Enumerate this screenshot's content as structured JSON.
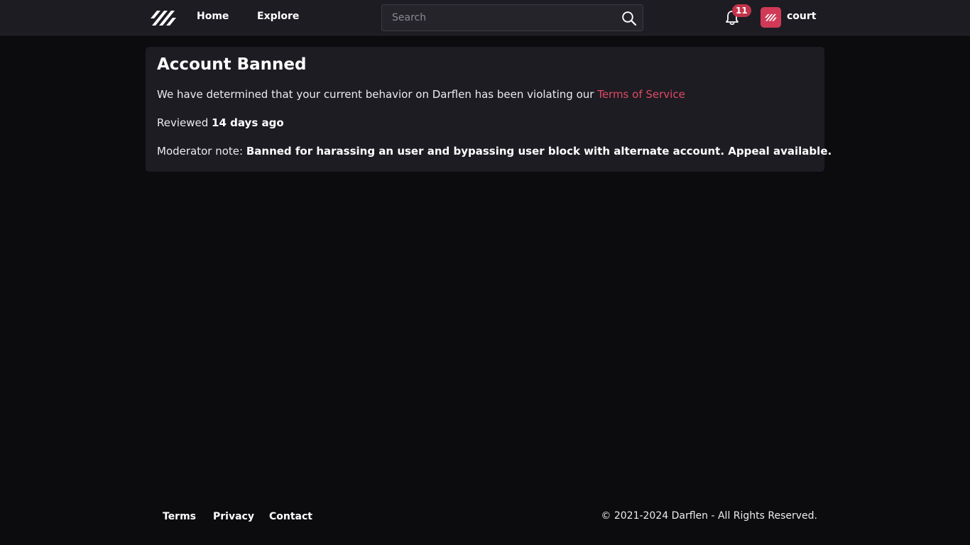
{
  "nav": {
    "logo_icon": "darflen-logo-icon",
    "home_label": "Home",
    "explore_label": "Explore",
    "search": {
      "placeholder": "Search",
      "value": "",
      "icon": "search-icon"
    },
    "notifications": {
      "icon": "bell-icon",
      "count": "11"
    },
    "user": {
      "avatar_icon": "darflen-logo-icon",
      "name": "court"
    }
  },
  "ban": {
    "title": "Account Banned",
    "message_prefix": "We have determined that your current behavior on Darflen has been violating our ",
    "terms_link": "Terms of Service",
    "reviewed_label": "Reviewed ",
    "reviewed_value": "14 days ago",
    "note_label": "Moderator note: ",
    "note_value": "Banned for harassing an user and bypassing user block with alternate account. Appeal available."
  },
  "footer": {
    "links": [
      "Terms",
      "Privacy",
      "Contact"
    ],
    "copyright": "© 2021-2024 Darflen - All Rights Reserved."
  },
  "colors": {
    "background": "#0c0c0f",
    "surface": "#1d1c23",
    "accent": "#e04a63",
    "badge": "#c2344a",
    "avatar": "#d13a57"
  }
}
